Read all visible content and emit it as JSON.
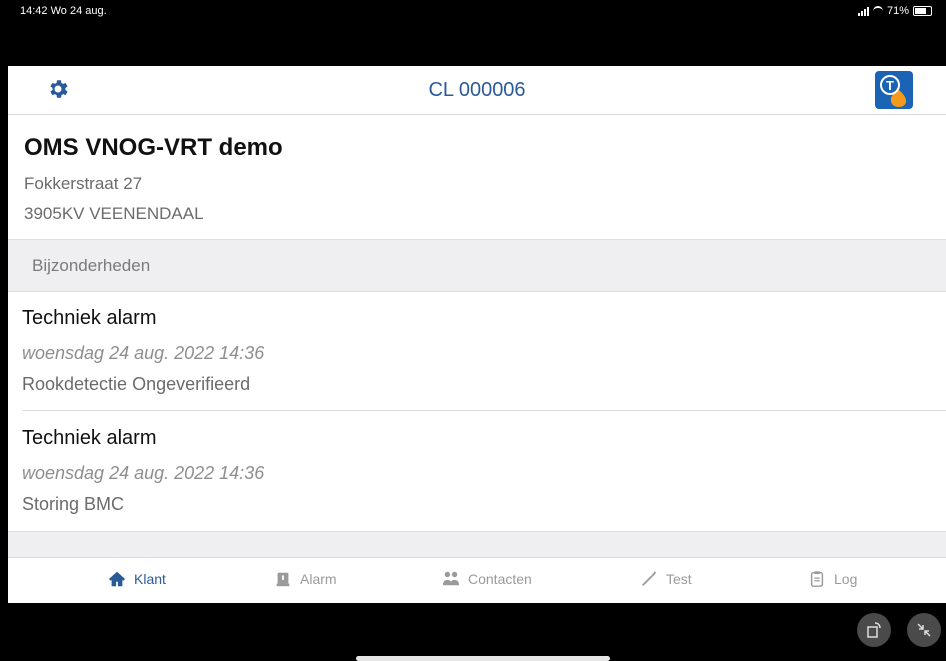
{
  "status": {
    "time": "14:42",
    "date": "Wo 24 aug.",
    "battery": "71%"
  },
  "header": {
    "title": "CL 000006",
    "settings_icon": "gear-icon",
    "logo_letter": "T"
  },
  "customer": {
    "name": "OMS VNOG-VRT demo",
    "street": "Fokkerstraat 27",
    "city": "3905KV  VEENENDAAL"
  },
  "section": {
    "label": "Bijzonderheden"
  },
  "alarms": [
    {
      "title": "Techniek alarm",
      "date": "woensdag 24 aug. 2022 14:36",
      "description": "Rookdetectie Ongeverifieerd"
    },
    {
      "title": "Techniek alarm",
      "date": "woensdag 24 aug. 2022 14:36",
      "description": "Storing BMC"
    }
  ],
  "tabs": [
    {
      "label": "Klant",
      "icon": "home-icon",
      "active": true
    },
    {
      "label": "Alarm",
      "icon": "alarm-icon",
      "active": false
    },
    {
      "label": "Contacten",
      "icon": "contacts-icon",
      "active": false
    },
    {
      "label": "Test",
      "icon": "test-icon",
      "active": false
    },
    {
      "label": "Log",
      "icon": "clipboard-icon",
      "active": false
    }
  ],
  "colors": {
    "accent": "#2a5a9a",
    "logo_bg": "#1b63b5",
    "logo_flame": "#f39a1e"
  }
}
